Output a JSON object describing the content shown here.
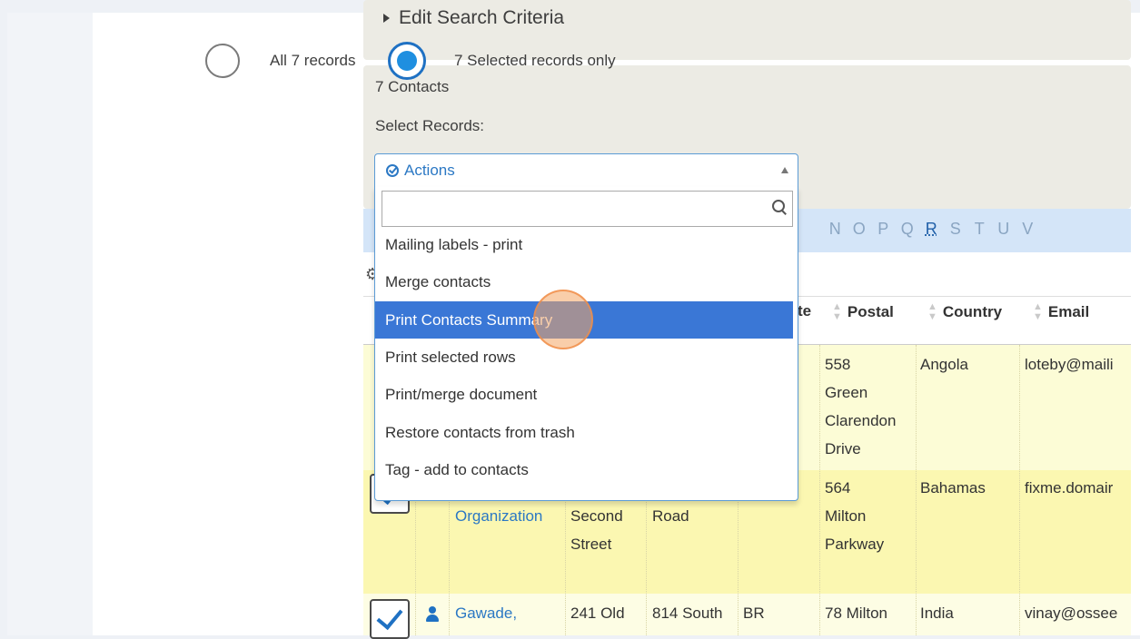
{
  "criteria": {
    "title": "Edit Search Criteria"
  },
  "contacts": {
    "count_label": "7 Contacts",
    "select_records_label": "Select Records:",
    "option_all": "All 7 records",
    "option_selected": "7 Selected records only",
    "selected_option": "7 Selected records only"
  },
  "actions": {
    "label": "Actions",
    "search_placeholder": "",
    "items": [
      "Mailing labels - print",
      "Merge contacts",
      "Print Contacts Summary",
      "Print selected rows",
      "Print/merge document",
      "Restore contacts from trash",
      "Tag - add to contacts"
    ],
    "highlighted": "Print Contacts Summary"
  },
  "alphabet": {
    "letters": [
      "N",
      "O",
      "P",
      "Q",
      "R",
      "S",
      "T",
      "U",
      "V"
    ],
    "active": "R"
  },
  "table": {
    "headers": {
      "state_partial": "te",
      "postal": "Postal",
      "country": "Country",
      "email": "Email"
    },
    "rows": [
      {
        "postal": [
          "558",
          "Green",
          "Clarendon",
          "Drive"
        ],
        "country": "Angola",
        "email": "loteby@maili"
      },
      {
        "name": "Organization",
        "street": [
          "Second",
          "Street"
        ],
        "city": "Road",
        "postal": [
          "564",
          "Milton",
          "Parkway"
        ],
        "country": "Bahamas",
        "email": "fixme.domair"
      },
      {
        "name": "Gawade,",
        "street": "241 Old",
        "city": "814 South",
        "state": "BR",
        "postal": "78 Milton",
        "country": "India",
        "email": "vinay@ossee"
      }
    ]
  },
  "colors": {
    "accent": "#1f71c3",
    "highlight": "#3a77d6",
    "link": "#2b78c4"
  }
}
